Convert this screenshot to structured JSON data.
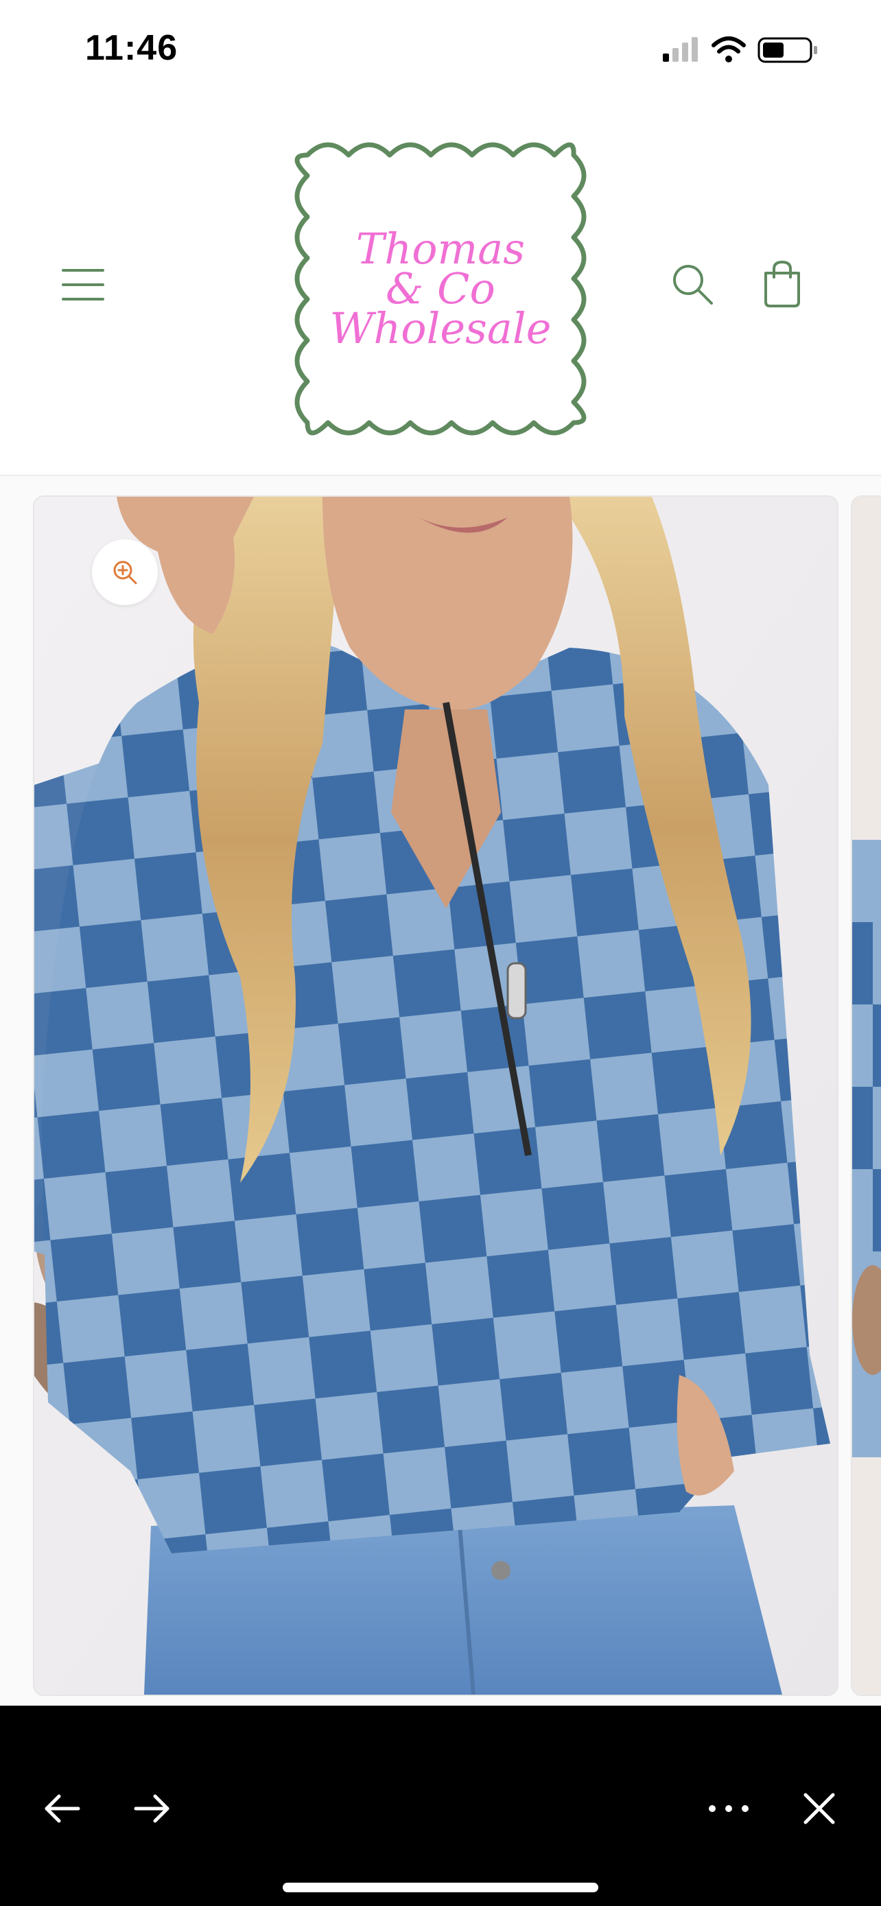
{
  "status_bar": {
    "time": "11:46"
  },
  "header": {
    "logo": {
      "line1": "Thomas",
      "line2": "& Co",
      "line3": "Wholesale"
    },
    "icons": [
      "hamburger-menu-icon",
      "search-icon",
      "cart-icon"
    ]
  },
  "gallery": {
    "main_image_alt": "Checkered denim half-zip pullover",
    "zoom_icon": "zoom-in-icon"
  },
  "toolbar": {
    "icons": [
      "back-arrow-icon",
      "forward-arrow-icon",
      "more-icon",
      "close-icon"
    ]
  },
  "colors": {
    "brand_green": "#5f8a5e",
    "logo_pink": "#f06fd4",
    "zoom_accent": "#e07a3a",
    "toolbar_bg": "#000000"
  }
}
